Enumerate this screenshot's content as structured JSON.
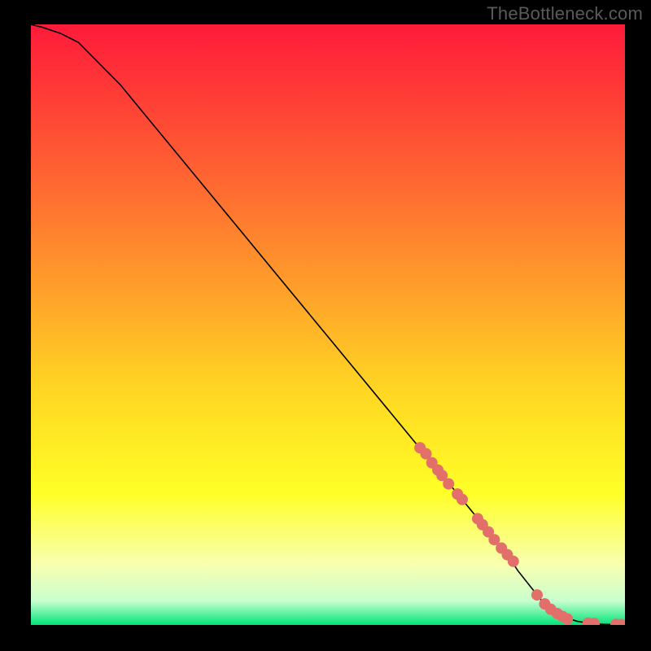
{
  "watermark": "TheBottleneck.com",
  "chart_data": {
    "type": "line",
    "title": "",
    "xlabel": "",
    "ylabel": "",
    "xlim": [
      0,
      100
    ],
    "ylim": [
      0,
      100
    ],
    "grid": false,
    "legend": false,
    "curve": {
      "name": "bottleneck-curve",
      "x": [
        0,
        2,
        5,
        8,
        10,
        15,
        20,
        25,
        30,
        35,
        40,
        45,
        50,
        55,
        60,
        65,
        70,
        75,
        80,
        82,
        84,
        86,
        88,
        90,
        92,
        95,
        100
      ],
      "y": [
        100,
        99.5,
        98.5,
        97,
        95,
        90,
        84,
        78,
        72,
        66,
        60,
        54,
        48,
        42,
        36,
        30,
        24,
        18,
        12,
        9,
        6.5,
        4,
        2.3,
        1.2,
        0.6,
        0.15,
        0.0
      ]
    },
    "scatter_points": {
      "name": "marked-points",
      "color": "#e36f6a",
      "radius": 7,
      "points": [
        {
          "x": 65.5,
          "y": 29.5
        },
        {
          "x": 66.5,
          "y": 28.5
        },
        {
          "x": 67.5,
          "y": 27.0
        },
        {
          "x": 68.5,
          "y": 25.8
        },
        {
          "x": 69.2,
          "y": 24.9
        },
        {
          "x": 70.3,
          "y": 23.5
        },
        {
          "x": 71.8,
          "y": 21.8
        },
        {
          "x": 72.6,
          "y": 20.9
        },
        {
          "x": 75.2,
          "y": 17.7
        },
        {
          "x": 76.0,
          "y": 16.7
        },
        {
          "x": 77.0,
          "y": 15.5
        },
        {
          "x": 78.0,
          "y": 14.2
        },
        {
          "x": 79.2,
          "y": 12.8
        },
        {
          "x": 80.2,
          "y": 11.7
        },
        {
          "x": 81.2,
          "y": 10.6
        },
        {
          "x": 85.2,
          "y": 5.0
        },
        {
          "x": 86.5,
          "y": 3.5
        },
        {
          "x": 87.5,
          "y": 2.6
        },
        {
          "x": 88.6,
          "y": 1.9
        },
        {
          "x": 89.5,
          "y": 1.4
        },
        {
          "x": 90.3,
          "y": 1.0
        },
        {
          "x": 93.8,
          "y": 0.3
        },
        {
          "x": 94.8,
          "y": 0.25
        },
        {
          "x": 98.5,
          "y": 0.1
        },
        {
          "x": 99.4,
          "y": 0.08
        }
      ]
    },
    "zones": {
      "type": "vertical-gradient",
      "stops": [
        {
          "value": 100,
          "color": "#ff1a3a"
        },
        {
          "value": 78,
          "color": "#ff5a33"
        },
        {
          "value": 55,
          "color": "#ffa22a"
        },
        {
          "value": 40,
          "color": "#ffd423"
        },
        {
          "value": 22,
          "color": "#ffff26"
        },
        {
          "value": 10,
          "color": "#f8ffb0"
        },
        {
          "value": 4,
          "color": "#c8ffcf"
        },
        {
          "value": 0,
          "color": "#00e579"
        }
      ]
    }
  }
}
